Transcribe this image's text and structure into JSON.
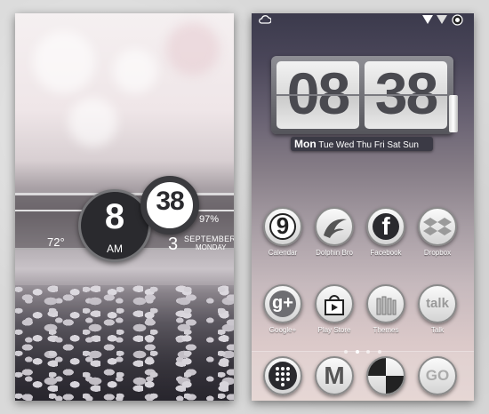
{
  "lockscreen": {
    "temperature": "72°",
    "hour": "8",
    "ampm": "AM",
    "minute": "38",
    "battery": "97%",
    "date_day": "3",
    "date_month": "SEPTEMBER",
    "date_weekday": "MONDAY"
  },
  "homescreen": {
    "clock_hour": "08",
    "clock_minute": "38",
    "weekday_current": "Mon",
    "weekdays_rest": "Tue Wed Thu Fri Sat Sun",
    "apps": [
      {
        "label": "Calendar",
        "glyph": "9"
      },
      {
        "label": "Dolphin Bro",
        "glyph": ""
      },
      {
        "label": "Facebook",
        "glyph": "f"
      },
      {
        "label": "Dropbox",
        "glyph": ""
      },
      {
        "label": "Google+",
        "glyph": "g+"
      },
      {
        "label": "Play Store",
        "glyph": ""
      },
      {
        "label": "Themes",
        "glyph": ""
      },
      {
        "label": "Talk",
        "glyph": "talk"
      }
    ],
    "dock": [
      {
        "name": "phone-dialer",
        "glyph": ""
      },
      {
        "name": "gmail",
        "glyph": "M"
      },
      {
        "name": "launcher",
        "glyph": ""
      },
      {
        "name": "go-launcher",
        "glyph": "GO"
      }
    ]
  },
  "colors": {
    "accent_dark": "#2a2a2e",
    "icon_face": "#fafafa"
  }
}
